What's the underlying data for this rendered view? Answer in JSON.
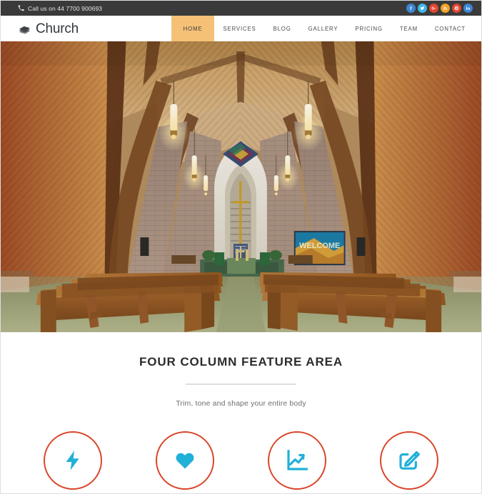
{
  "topbar": {
    "phone_icon": "phone-icon",
    "phone_text": "Call us on 44 7700 900693",
    "social": [
      {
        "name": "facebook",
        "glyph": "f",
        "color": "#3b86d3"
      },
      {
        "name": "twitter",
        "glyph": "t",
        "color": "#3fb8e8"
      },
      {
        "name": "google-plus",
        "glyph": "G+",
        "color": "#e0452e"
      },
      {
        "name": "rss",
        "glyph": "r",
        "color": "#efa128"
      },
      {
        "name": "pinterest",
        "glyph": "P",
        "color": "#e0452e"
      },
      {
        "name": "linkedin",
        "glyph": "in",
        "color": "#3b86d3"
      }
    ],
    "bg_color": "#3a3a3a"
  },
  "header": {
    "logo_icon": "books-icon",
    "brand": "Church",
    "active_color": "#f5c177",
    "nav": [
      {
        "label": "HOME",
        "active": true
      },
      {
        "label": "SERVICES",
        "active": false
      },
      {
        "label": "BLOG",
        "active": false
      },
      {
        "label": "GALLERY",
        "active": false
      },
      {
        "label": "PRICING",
        "active": false
      },
      {
        "label": "TEAM",
        "active": false
      },
      {
        "label": "CONTACT",
        "active": false
      }
    ]
  },
  "hero": {
    "name": "church-interior-photo",
    "alt": "Church interior with wooden vaulted ceiling, brick walls, cross, pendant lights and wooden pews",
    "screen_text": "WELCOME"
  },
  "features": {
    "title": "FOUR COLUMN FEATURE AREA",
    "subtitle": "Trim, tone and shape your entire body",
    "circle_color": "#d9472b",
    "icon_color": "#21b0d8",
    "items": [
      {
        "icon": "lightning-bolt-icon"
      },
      {
        "icon": "heart-icon"
      },
      {
        "icon": "line-chart-up-icon"
      },
      {
        "icon": "edit-pencil-square-icon"
      }
    ]
  }
}
